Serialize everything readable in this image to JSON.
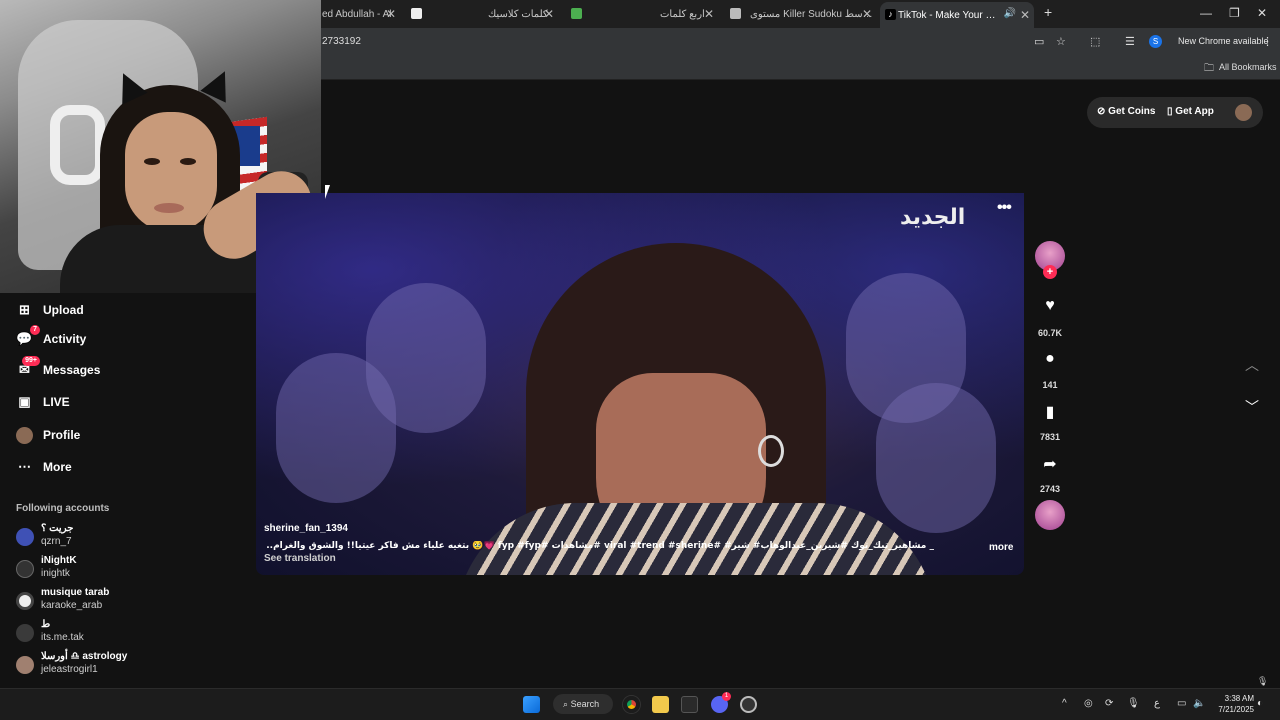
{
  "browser": {
    "tabs": [
      {
        "label": "ed Abdullah - Al",
        "active": false
      },
      {
        "label": "كلمات كلاسيك",
        "active": false
      },
      {
        "label": "أربع كلمات",
        "active": false
      },
      {
        "label": "مستوى Killer Sudoku المتوسط",
        "active": false
      },
      {
        "label": "TikTok - Make Your Day",
        "active": true
      }
    ],
    "url_partial": "2733192",
    "profile_letter": "S",
    "new_chrome_label": "New Chrome available",
    "all_bookmarks_label": "All Bookmarks"
  },
  "tiktok": {
    "header": {
      "get_coins_label": "Get Coins",
      "get_app_label": "Get App"
    },
    "sidebar": {
      "items": [
        {
          "label": "Upload",
          "icon": "plus-square-icon"
        },
        {
          "label": "Activity",
          "icon": "activity-icon",
          "badge": "7"
        },
        {
          "label": "Messages",
          "icon": "messages-icon",
          "badge": "99+"
        },
        {
          "label": "LIVE",
          "icon": "live-icon"
        },
        {
          "label": "Profile",
          "icon": "profile-avatar"
        },
        {
          "label": "More",
          "icon": "more-icon"
        }
      ],
      "following_title": "Following accounts",
      "following": [
        {
          "name": "جريت ؟",
          "username": "qzrn_7"
        },
        {
          "name": "iNightK",
          "username": "inightk"
        },
        {
          "name": "musique tarab",
          "username": "karaoke_arab"
        },
        {
          "name": "ط",
          "username": "its.me.tak"
        },
        {
          "name": "أورسلا ♎︎ astrology",
          "username": "jeleastrogirl1"
        }
      ]
    },
    "video": {
      "channel_logo": "الجديد",
      "author": "sherine_fan_1394",
      "caption": "_ مشاهير_تيك_توك #شيرين_عبدالوهاب# شير# #viral #trend #sherine #مشاهدات #fyp #fyp 💗🥹 بتغيه علياء مش فاكر عيتيا!! والشوق والغرام.. صوتها سحر أعظم مطربه في الوطن العربي كله",
      "see_translation": "See translation",
      "more_link": "more",
      "likes": "60.7K",
      "comments": "141",
      "saves": "7831",
      "shares": "2743"
    }
  },
  "taskbar": {
    "search_label": "Search",
    "discord_badge": "1",
    "ime_label": "ع",
    "time": "3:38 AM",
    "date": "7/21/2025"
  },
  "colors": {
    "tiktok_red": "#fe2c55",
    "background": "#121212",
    "chrome_bg": "#1f1f1f"
  }
}
